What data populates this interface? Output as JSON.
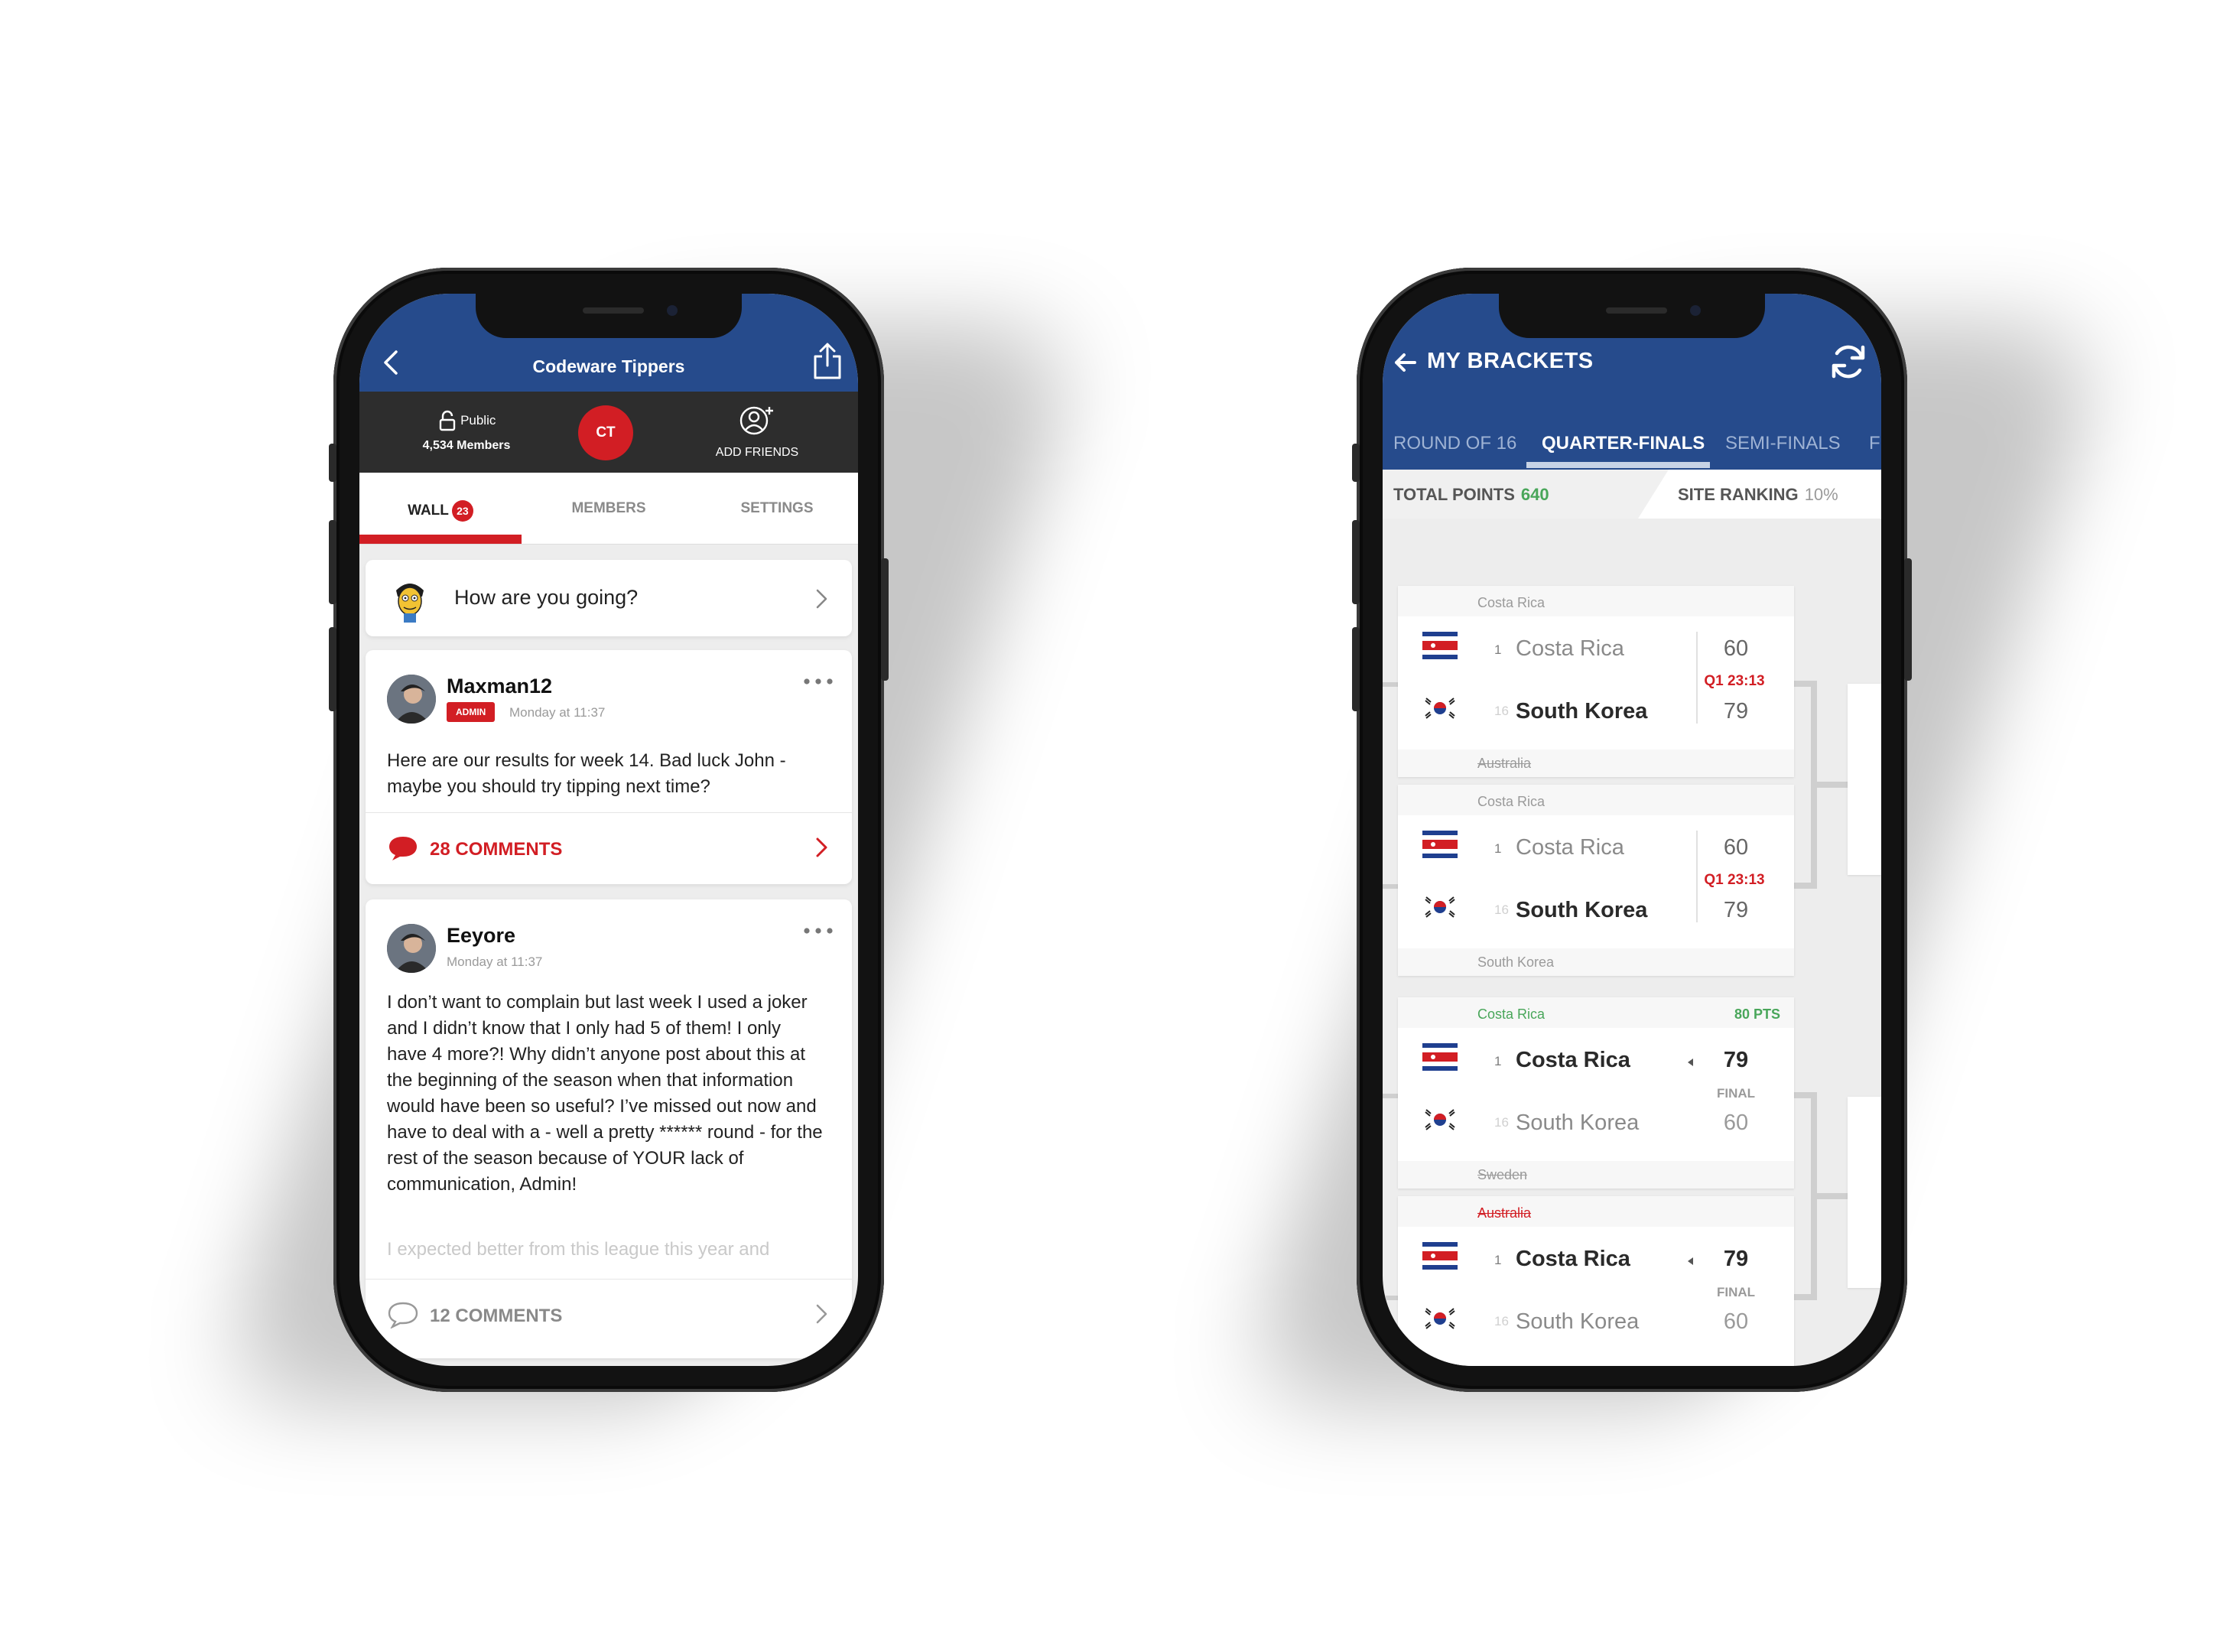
{
  "left_phone": {
    "header": {
      "title": "Codeware Tippers"
    },
    "info": {
      "privacy": "Public",
      "members": "4,534 Members",
      "badge": "CT",
      "add_friends": "ADD FRIENDS"
    },
    "tabs": [
      {
        "label": "WALL",
        "badge": "23"
      },
      {
        "label": "MEMBERS"
      },
      {
        "label": "SETTINGS"
      }
    ],
    "compose": {
      "placeholder": "How are you going?"
    },
    "posts": [
      {
        "author": "Maxman12",
        "role": "ADMIN",
        "time": "Monday at 11:37",
        "body": "Here are our results for week 14. Bad luck John - maybe you should try tipping next time?",
        "comments": "28 COMMENTS"
      },
      {
        "author": "Eeyore",
        "time": "Monday at 11:37",
        "body": "I don’t want to complain but last week I used a joker and I didn’t know that I only had 5 of them! I only have 4 more?! Why didn’t anyone post about this at the beginning of the season when that information would have been so useful? I’ve missed out now and have to deal with a - well a pretty ****** round - for the rest of the season because of YOUR lack of communication, Admin!",
        "faded": "I expected better from this league this year and",
        "comments": "12 COMMENTS"
      }
    ]
  },
  "right_phone": {
    "header": {
      "title": "MY BRACKETS"
    },
    "tabs": [
      "ROUND OF 16",
      "QUARTER-FINALS",
      "SEMI-FINALS",
      "F"
    ],
    "stats": {
      "total_points_label": "TOTAL POINTS",
      "total_points": "640",
      "site_ranking_label": "SITE RANKING",
      "site_ranking": "10%"
    },
    "matches": [
      {
        "pick": "Costa Rica",
        "pts": "",
        "home": {
          "seed": "1",
          "team": "Costa Rica",
          "score": "60"
        },
        "away": {
          "seed": "16",
          "team": "South Korea",
          "score": "79"
        },
        "status": "Q1 23:13",
        "bottom": "Australia"
      },
      {
        "pick": "Costa Rica",
        "pts": "",
        "home": {
          "seed": "1",
          "team": "Costa Rica",
          "score": "60"
        },
        "away": {
          "seed": "16",
          "team": "South Korea",
          "score": "79"
        },
        "status": "Q1 23:13",
        "bottom": "South Korea"
      },
      {
        "pick": "Costa Rica",
        "pts": "80 PTS",
        "home": {
          "seed": "1",
          "team": "Costa Rica",
          "score": "79"
        },
        "away": {
          "seed": "16",
          "team": "South Korea",
          "score": "60"
        },
        "status": "FINAL",
        "bottom": "Sweden"
      },
      {
        "pick": "Australia",
        "pts": "",
        "home": {
          "seed": "1",
          "team": "Costa Rica",
          "score": "79"
        },
        "away": {
          "seed": "16",
          "team": "South Korea",
          "score": "60"
        },
        "status": "FINAL",
        "bottom": ""
      }
    ]
  },
  "colors": {
    "brand_blue": "#264b8c",
    "accent_red": "#d21e24",
    "points_green": "#49a65a",
    "dark_bar": "#2d2d2d"
  }
}
